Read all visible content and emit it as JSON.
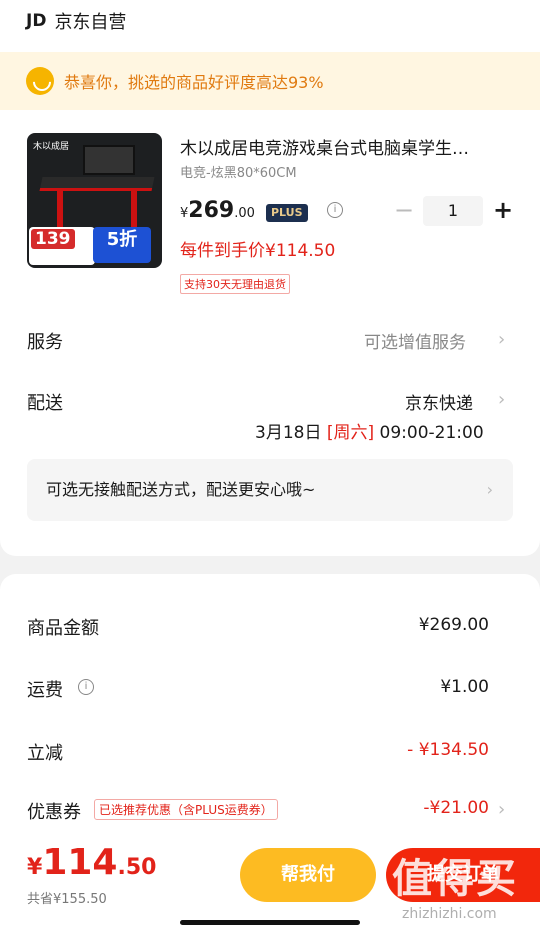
{
  "store": {
    "logo": "JD",
    "name": "京东自营"
  },
  "banner": {
    "text": "恭喜你，挑选的商品好评度高达93%",
    "icon": "smile-icon"
  },
  "product": {
    "thumb_logo": "木以成居",
    "thumb_price": "139",
    "thumb_discount": "5折",
    "title": "木以成居电竞游戏桌台式电脑桌学生…",
    "spec": "电竞-炫黑80*60CM",
    "price_symbol": "¥",
    "price_int": "269",
    "price_dec": ".00",
    "plus_badge": "PLUS",
    "quantity": "1",
    "net_price": "每件到手价¥114.50",
    "return_tag": "支持30天无理由退货"
  },
  "service": {
    "label": "服务",
    "value": "可选增值服务"
  },
  "delivery": {
    "label": "配送",
    "carrier": "京东快递",
    "date": "3月18日",
    "weekday": "[周六]",
    "time": "09:00-21:00"
  },
  "contactless": {
    "text": "可选无接触配送方式，配送更安心哦~"
  },
  "summary": {
    "goods_label": "商品金额",
    "goods_value": "¥269.00",
    "freight_label": "运费",
    "freight_value": "¥1.00",
    "discount_label": "立减",
    "discount_value": "- ¥134.50",
    "coupon_label": "优惠券",
    "coupon_tag": "已选推荐优惠（含PLUS运费券）",
    "coupon_value": "-¥21.00"
  },
  "footer": {
    "total_symbol": "¥",
    "total_int": "114",
    "total_dec": ".50",
    "saved": "共省¥155.50",
    "help_pay": "帮我付",
    "submit": "提交订单"
  },
  "watermark": {
    "text": "值得买",
    "url": "zhizhizhi.com"
  },
  "colors": {
    "accent_red": "#e2231a",
    "yellow": "#fdbb22",
    "banner_bg": "#fff6e1"
  }
}
